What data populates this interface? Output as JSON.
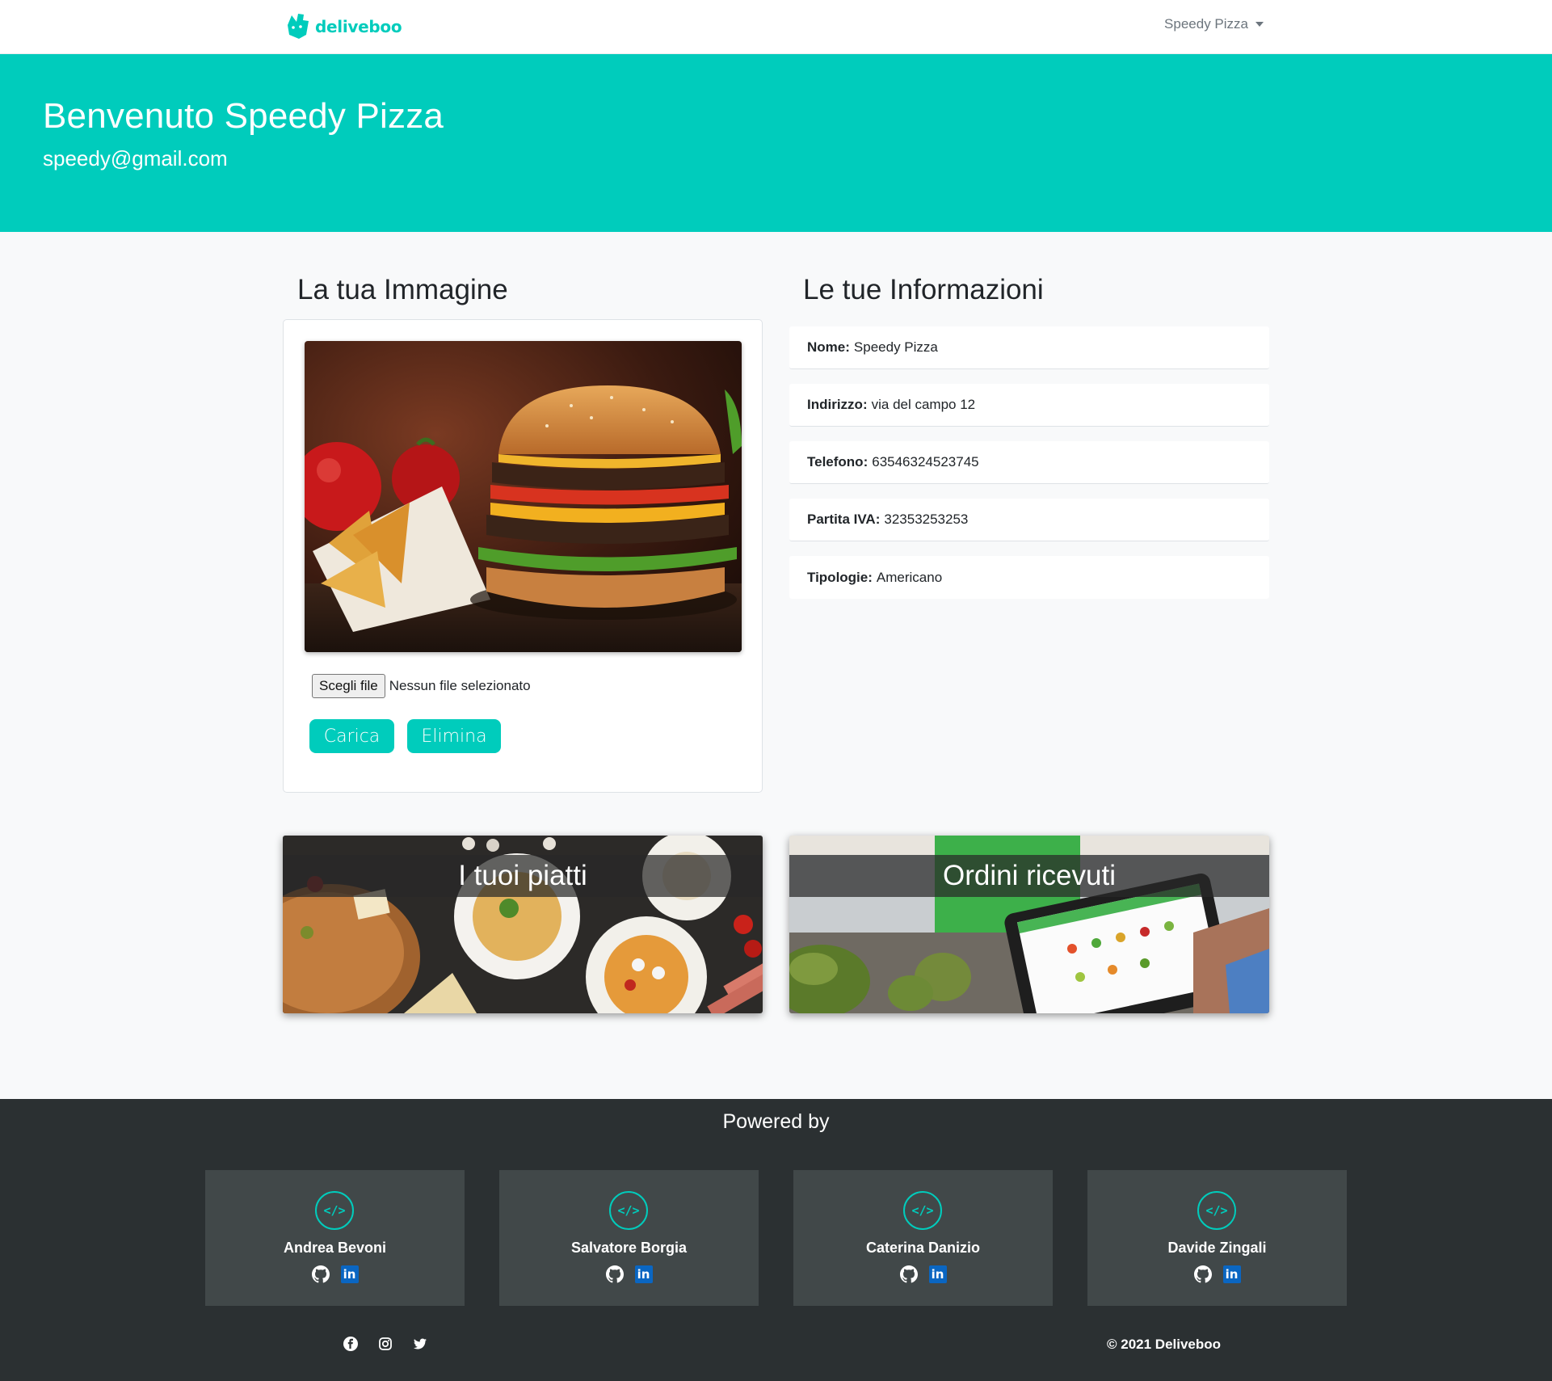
{
  "navbar": {
    "brand": "deliveboo",
    "user_menu": "Speedy Pizza"
  },
  "hero": {
    "title": "Benvenuto Speedy Pizza",
    "email": "speedy@gmail.com"
  },
  "image_section": {
    "title": "La tua Immagine",
    "file_button": "Scegli file",
    "file_status": "Nessun file selezionato",
    "upload_button": "Carica",
    "delete_button": "Elimina"
  },
  "info_section": {
    "title": "Le tue Informazioni",
    "items": [
      {
        "label": "Nome:",
        "value": "Speedy Pizza"
      },
      {
        "label": "Indirizzo:",
        "value": "via del campo 12"
      },
      {
        "label": "Telefono:",
        "value": "63546324523745"
      },
      {
        "label": "Partita IVA:",
        "value": "32353253253"
      },
      {
        "label": "Tipologie:",
        "value": "Americano"
      }
    ]
  },
  "features": {
    "dishes": "I tuoi piatti",
    "orders": "Ordini ricevuti"
  },
  "footer": {
    "powered_by": "Powered by",
    "developers": [
      {
        "name": "Andrea Bevoni"
      },
      {
        "name": "Salvatore Borgia"
      },
      {
        "name": "Caterina Danizio"
      },
      {
        "name": "Davide Zingali"
      }
    ],
    "dev_icon_glyph": "</>",
    "linkedin_glyph": "in",
    "social_icons": [
      "facebook-icon",
      "instagram-icon",
      "twitter-icon"
    ],
    "copyright": "© 2021 Deliveboo"
  },
  "colors": {
    "accent": "#00ccbc",
    "footer_bg": "#2b3032",
    "card_bg": "#414849"
  }
}
